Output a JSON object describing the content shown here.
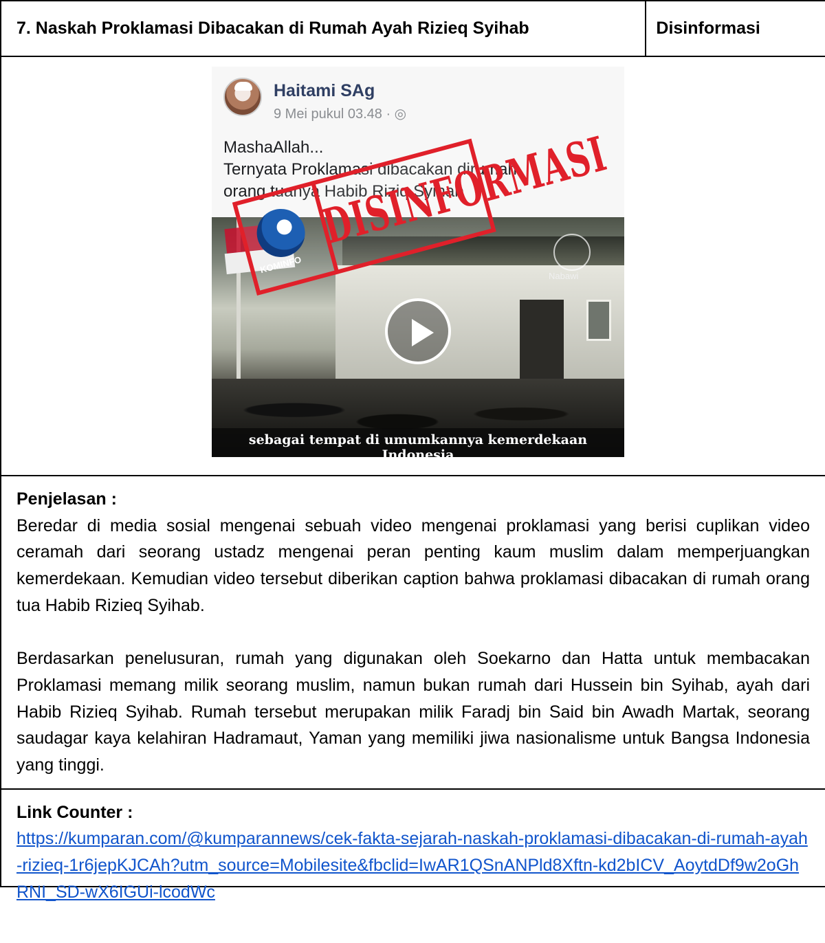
{
  "header": {
    "title": "7. Naskah Proklamasi Dibacakan di Rumah Ayah Rizieq Syihab",
    "status": "Disinformasi"
  },
  "post": {
    "author": "Haitami SAg",
    "meta": "9 Mei pukul 03.48 · ◎",
    "text_line1": "MashaAllah...",
    "text_line2": "Ternyata Proklamasi dibacakan dirumah",
    "text_line3": "orang tuanya Habib Riziq Syihab",
    "video_badge": "Nabawi",
    "video_caption": "sebagai tempat di umumkannya kemerdekaan Indonesia",
    "stamp_label": "DISINFORMASI",
    "stamp_logo_label": "KOMINFO",
    "icons": [
      "avatar",
      "globe-icon",
      "play-icon"
    ]
  },
  "explanation": {
    "label": "Penjelasan :",
    "paragraph1": "Beredar di media sosial mengenai sebuah video mengenai proklamasi yang berisi cuplikan video ceramah dari seorang ustadz mengenai peran penting kaum muslim dalam memperjuangkan kemerdekaan. Kemudian video tersebut diberikan caption bahwa proklamasi dibacakan di rumah orang tua Habib Rizieq Syihab.",
    "paragraph2": "Berdasarkan penelusuran, rumah yang digunakan oleh Soekarno dan Hatta untuk membacakan Proklamasi memang milik seorang muslim, namun bukan rumah dari Hussein bin Syihab, ayah dari Habib Rizieq Syihab. Rumah tersebut merupakan milik Faradj bin Said bin Awadh Martak, seorang saudagar kaya kelahiran Hadramaut, Yaman yang memiliki jiwa nasionalisme untuk Bangsa Indonesia yang tinggi."
  },
  "link_counter": {
    "label": "Link Counter :",
    "url": "https://kumparan.com/@kumparannews/cek-fakta-sejarah-naskah-proklamasi-dibacakan-di-rumah-ayah-rizieq-1r6jepKJCAh?utm_source=Mobilesite&fbclid=IwAR1QSnANPld8Xftn-kd2bICV_AoytdDf9w2oGhRNI_SD-wX6IGUi-lcodWc"
  },
  "colors": {
    "link": "#1155cc",
    "stamp": "#e0202a",
    "poster_name": "#2f3f63"
  }
}
